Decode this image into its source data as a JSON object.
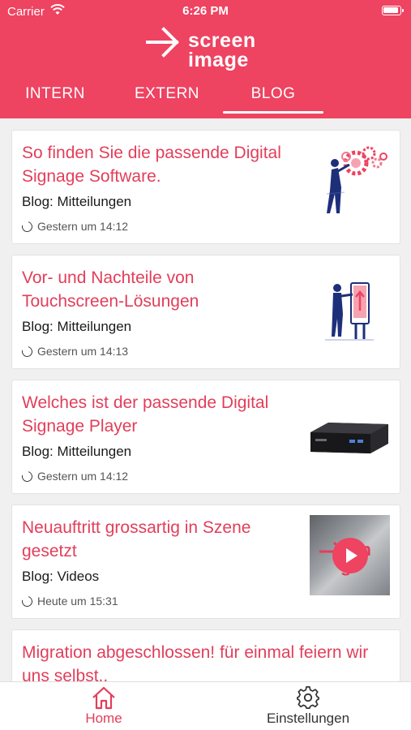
{
  "status_bar": {
    "carrier": "Carrier",
    "time": "6:26 PM"
  },
  "logo": {
    "line1": "screen",
    "line2": "image"
  },
  "tabs": [
    {
      "label": "INTERN",
      "active": false
    },
    {
      "label": "EXTERN",
      "active": false
    },
    {
      "label": "BLOG",
      "active": true
    }
  ],
  "posts": [
    {
      "title": "So finden Sie die passende Digital Signage Software.",
      "category": "Blog: Mitteilungen",
      "time": "Gestern um 14:12",
      "thumb": "gears-person-illustration"
    },
    {
      "title": "Vor- und Nachteile von Touchscreen-Lösungen",
      "category": "Blog: Mitteilungen",
      "time": "Gestern um 14:13",
      "thumb": "touchscreen-kiosk-illustration"
    },
    {
      "title": "Welches ist der passende Digital Signage Player",
      "category": "Blog: Mitteilungen",
      "time": "Gestern um 14:12",
      "thumb": "mini-pc-photo"
    },
    {
      "title": "Neuauftritt grossartig in Szene gesetzt",
      "category": "Blog: Videos",
      "time": "Heute um 15:31",
      "thumb": "video-thumbnail"
    },
    {
      "title": "Migration abgeschlossen! für einmal feiern wir uns selbst.."
    }
  ],
  "video_thumb_text": {
    "line1": "een",
    "line2": "ge"
  },
  "bottom_nav": [
    {
      "label": "Home",
      "icon": "home-icon",
      "active": true
    },
    {
      "label": "Einstellungen",
      "icon": "gear-icon",
      "active": false
    }
  ],
  "colors": {
    "brand": "#ee4361",
    "title_text": "#e23e5a",
    "background": "#f0f0f0"
  }
}
